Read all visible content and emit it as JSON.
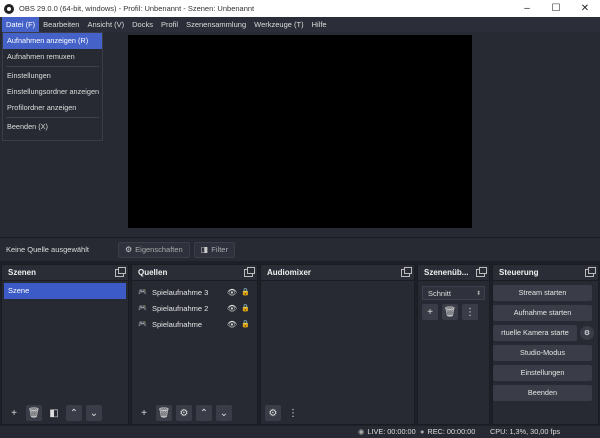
{
  "window": {
    "title": "OBS 29.0.0 (64-bit, windows) - Profil: Unbenannt - Szenen: Unbenannt",
    "minimize": "–",
    "maximize": "☐",
    "close": "✕"
  },
  "menubar": {
    "items": [
      "Datei (F)",
      "Bearbeiten",
      "Ansicht (V)",
      "Docks",
      "Profil",
      "Szenensammlung",
      "Werkzeuge (T)",
      "Hilfe"
    ]
  },
  "file_menu": {
    "items": [
      "Aufnahmen anzeigen (R)",
      "Aufnahmen remuxen",
      "Einstellungen",
      "Einstellungsordner anzeigen",
      "Profilordner anzeigen",
      "Beenden (X)"
    ]
  },
  "source_toolbar": {
    "status": "Keine Quelle ausgewählt",
    "properties": "Eigenschaften",
    "filter": "Filter"
  },
  "docks": {
    "scenes": {
      "title": "Szenen",
      "items": [
        "Szene"
      ]
    },
    "sources": {
      "title": "Quellen",
      "items": [
        "Spielaufnahme 3",
        "Spielaufnahme 2",
        "Spielaufnahme"
      ]
    },
    "audio": {
      "title": "Audiomixer"
    },
    "transitions": {
      "title": "Szenenüb...",
      "selected": "Schnitt"
    },
    "controls": {
      "title": "Steuerung",
      "stream": "Stream starten",
      "record": "Aufnahme starten",
      "vcam": "rtuelle Kamera starte",
      "studio": "Studio-Modus",
      "settings": "Einstellungen",
      "exit": "Beenden"
    }
  },
  "status": {
    "live": "LIVE: 00:00:00",
    "rec": "REC: 00:00:00",
    "cpu": "CPU: 1,3%, 30,00 fps"
  }
}
